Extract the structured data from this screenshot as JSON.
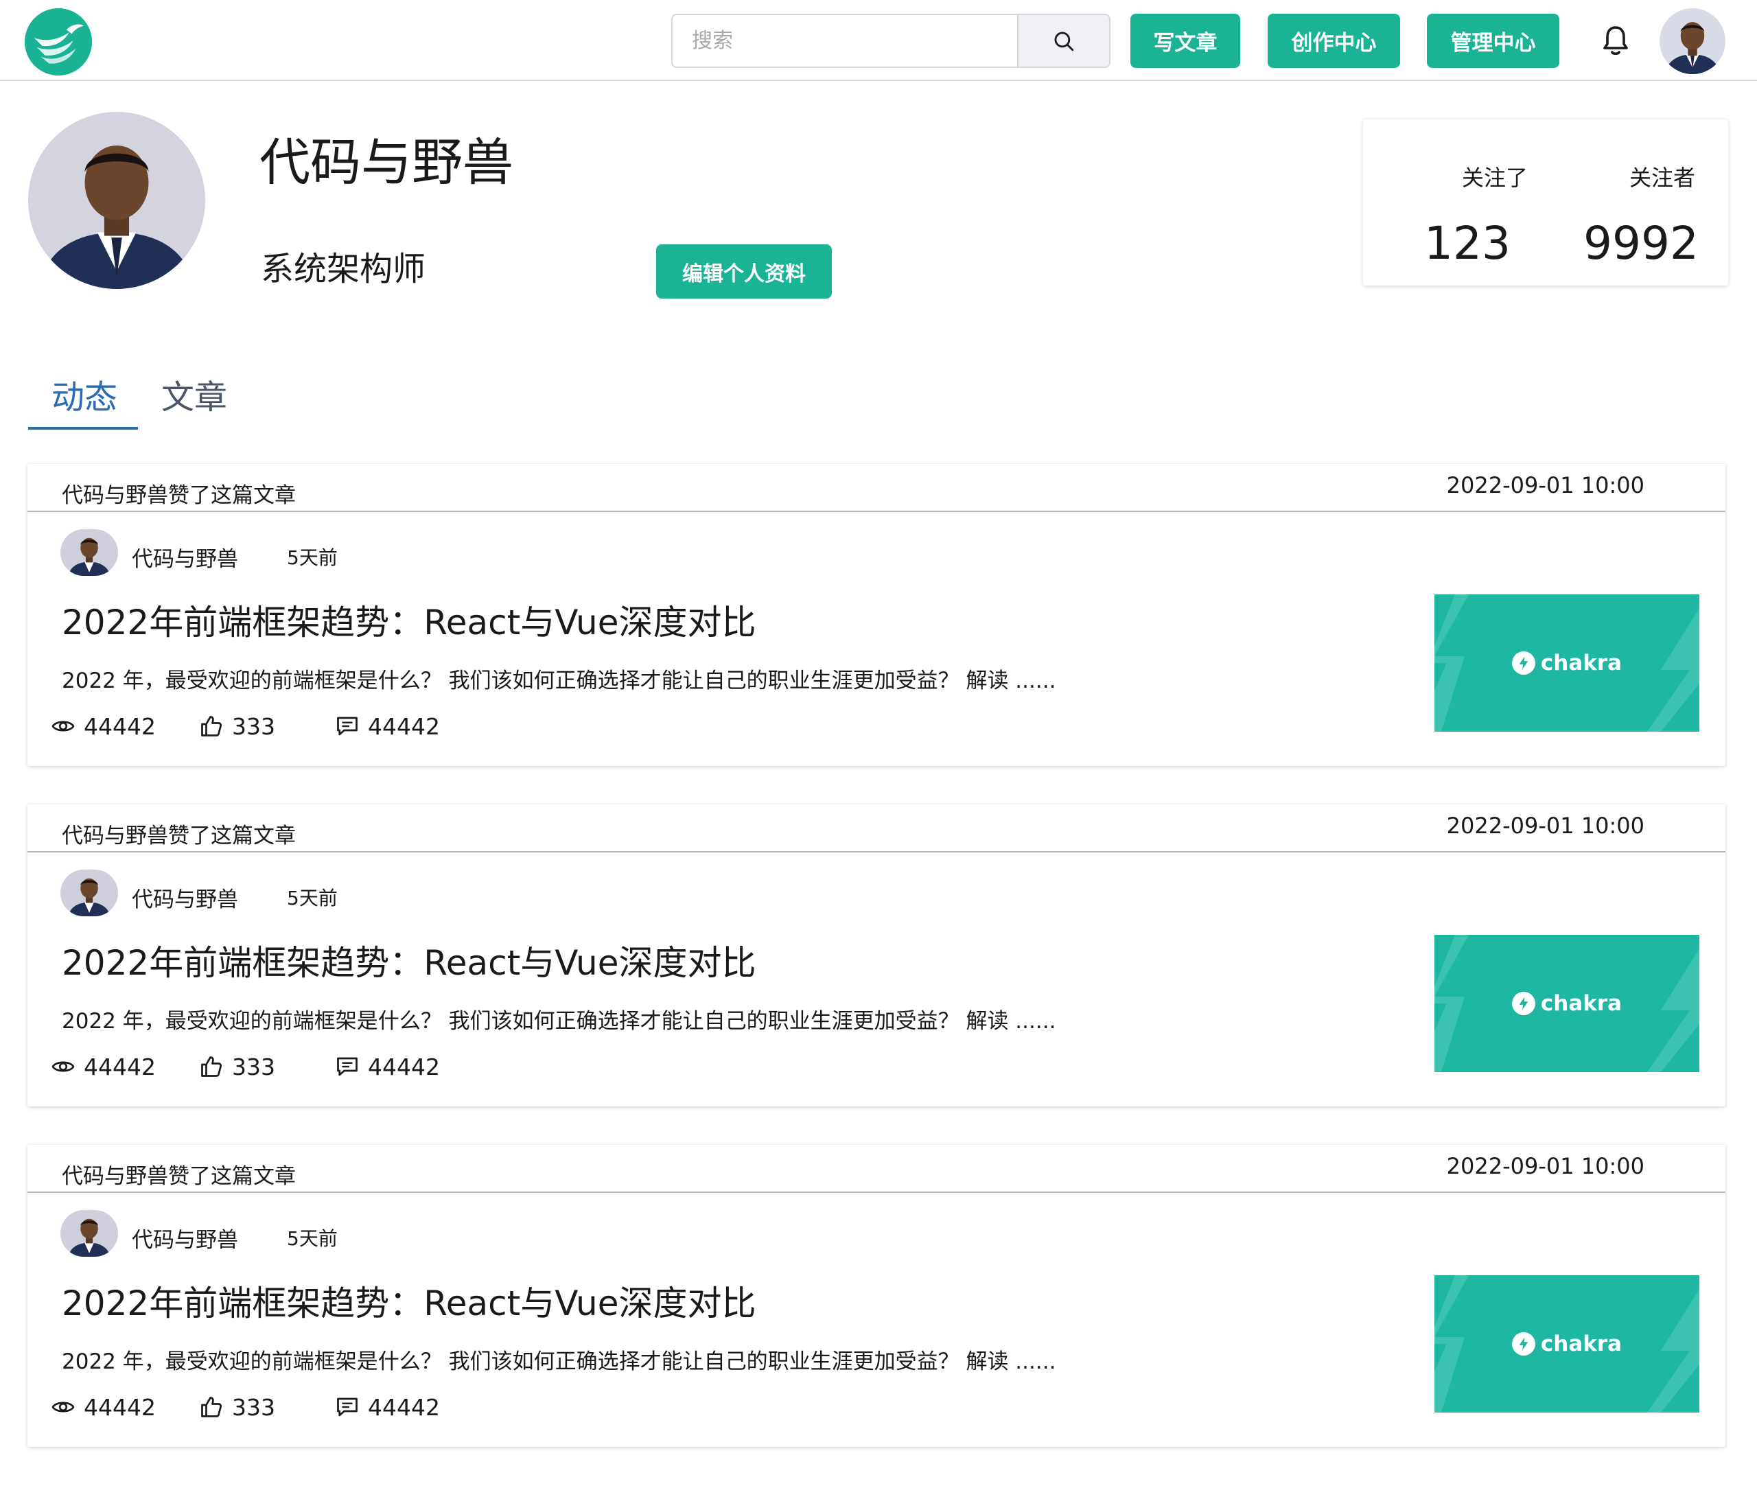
{
  "header": {
    "search_placeholder": "搜索",
    "write_label": "写文章",
    "creator_label": "创作中心",
    "admin_label": "管理中心"
  },
  "profile": {
    "name": "代码与野兽",
    "role": "系统架构师",
    "edit_label": "编辑个人资料",
    "following_label": "关注了",
    "following_count": "123",
    "followers_label": "关注者",
    "followers_count": "9992"
  },
  "tabs": [
    {
      "label": "动态",
      "active": true
    },
    {
      "label": "文章",
      "active": false
    }
  ],
  "activities": [
    {
      "action": "代码与野兽赞了这篇文章",
      "time": "2022-09-01 10:00",
      "author": "代码与野兽",
      "ago": "5天前",
      "title": "2022年前端框架趋势：React与Vue深度对比",
      "summary": "2022 年，最受欢迎的前端框架是什么？ 我们该如何正确选择才能让自己的职业生涯更加受益？ 解读 ......",
      "views": "44442",
      "likes": "333",
      "comments": "44442",
      "thumb_label": "chakra"
    },
    {
      "action": "代码与野兽赞了这篇文章",
      "time": "2022-09-01 10:00",
      "author": "代码与野兽",
      "ago": "5天前",
      "title": "2022年前端框架趋势：React与Vue深度对比",
      "summary": "2022 年，最受欢迎的前端框架是什么？ 我们该如何正确选择才能让自己的职业生涯更加受益？ 解读 ......",
      "views": "44442",
      "likes": "333",
      "comments": "44442",
      "thumb_label": "chakra"
    },
    {
      "action": "代码与野兽赞了这篇文章",
      "time": "2022-09-01 10:00",
      "author": "代码与野兽",
      "ago": "5天前",
      "title": "2022年前端框架趋势：React与Vue深度对比",
      "summary": "2022 年，最受欢迎的前端框架是什么？ 我们该如何正确选择才能让自己的职业生涯更加受益？ 解读 ......",
      "views": "44442",
      "likes": "333",
      "comments": "44442",
      "thumb_label": "chakra"
    }
  ],
  "icons": {
    "logo": "bird-logo-icon",
    "search": "search-icon",
    "bell": "bell-icon",
    "views": "eye-icon",
    "likes": "thumbs-up-icon",
    "comments": "comment-icon",
    "thumb": "chakra-bolt-icon"
  },
  "colors": {
    "brand": "#1ab394",
    "tab_active": "#2b6cb0",
    "thumb_bg": "#1eb8a2"
  }
}
